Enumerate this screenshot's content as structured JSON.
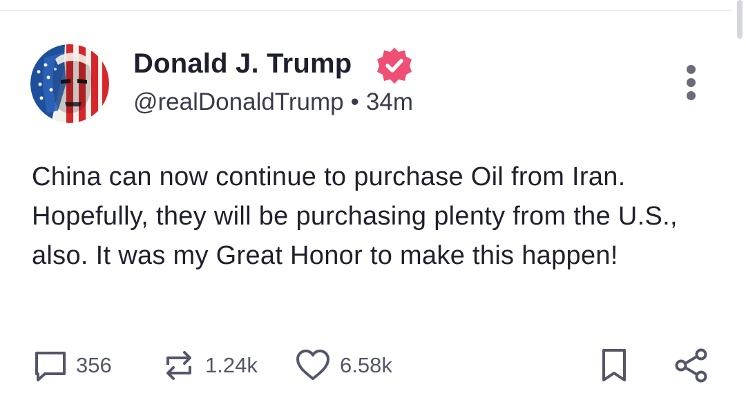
{
  "post": {
    "author": {
      "display_name": "Donald J. Trump",
      "handle": "@realDonaldTrump",
      "verified": true
    },
    "separator": "•",
    "time_ago": "34m",
    "body": "China can now continue to purchase Oil from Iran. Hopefully, they will be purchasing plenty from the U.S., also. It was my Great Honor to make this happen!",
    "stats": {
      "comments": "356",
      "reposts": "1.24k",
      "likes": "6.58k"
    }
  },
  "colors": {
    "verified_badge": "#ef4f75",
    "icon_gray": "#55556a",
    "text_primary": "#1f1f2e"
  },
  "icons": {
    "more": "more-vertical-icon",
    "comment": "comment-icon",
    "repost": "repost-icon",
    "like": "heart-icon",
    "bookmark": "bookmark-icon",
    "share": "share-icon"
  }
}
